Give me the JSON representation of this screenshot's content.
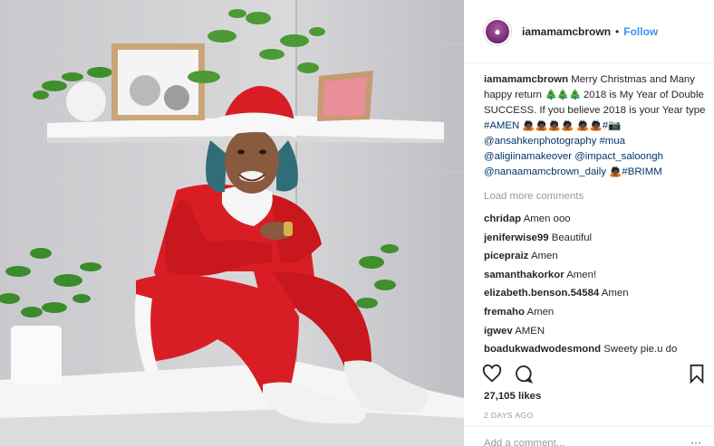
{
  "post": {
    "username": "iamamamcbrown",
    "follow_separator": "•",
    "follow_label": "Follow",
    "avatar_icon": "profile-avatar-icon",
    "photo_description_icons": [
      "santa-hat",
      "plant-pot",
      "picture-frame"
    ]
  },
  "caption": {
    "username": "iamamamcbrown",
    "text_1": "Merry Christmas and Many happy return",
    "trees": "🎄🎄🎄",
    "text_2": "2018 is My Year of Double SUCCESS. If you believe 2018 is your Year type",
    "hashtag_amen": "#AMEN",
    "people_1": "🙇🏿🙇🏿🙇🏿🙇🏿",
    "people_2": "🙇🏿🙇🏿",
    "hash_camera": "#📷",
    "mention_1": "@ansahkenphotography",
    "hashtag_mua": "#mua",
    "mention_2": "@aligiinamakeover",
    "mention_3": "@impact_saloongh",
    "mention_4": "@nanaamamcbrown_daily",
    "people_3": "🙇🏿",
    "hashtag_brimm": "#BRIMM"
  },
  "load_more": "Load more comments",
  "comments": [
    {
      "user": "chridap",
      "text": "Amen ooo"
    },
    {
      "user": "jeniferwise99",
      "text": "Beautiful"
    },
    {
      "user": "picepraiz",
      "text": "Amen"
    },
    {
      "user": "samanthakorkor",
      "text": "Amen!"
    },
    {
      "user": "elizabeth.benson.54584",
      "text": "Amen"
    },
    {
      "user": "fremaho",
      "text": "Amen"
    },
    {
      "user": "igwev",
      "text": "AMEN"
    },
    {
      "user": "boadukwadwodesmond",
      "text": "Sweety pie.u do"
    }
  ],
  "actions": {
    "like_icon": "heart-icon",
    "comment_icon": "comment-bubble-icon",
    "save_icon": "bookmark-icon"
  },
  "likes": "27,105 likes",
  "timestamp": "2 DAYS AGO",
  "add_comment_placeholder": "Add a comment...",
  "more_label": "···",
  "colors": {
    "link": "#003569",
    "follow": "#3897f0",
    "muted": "#999999",
    "santa_red": "#d81e24"
  }
}
